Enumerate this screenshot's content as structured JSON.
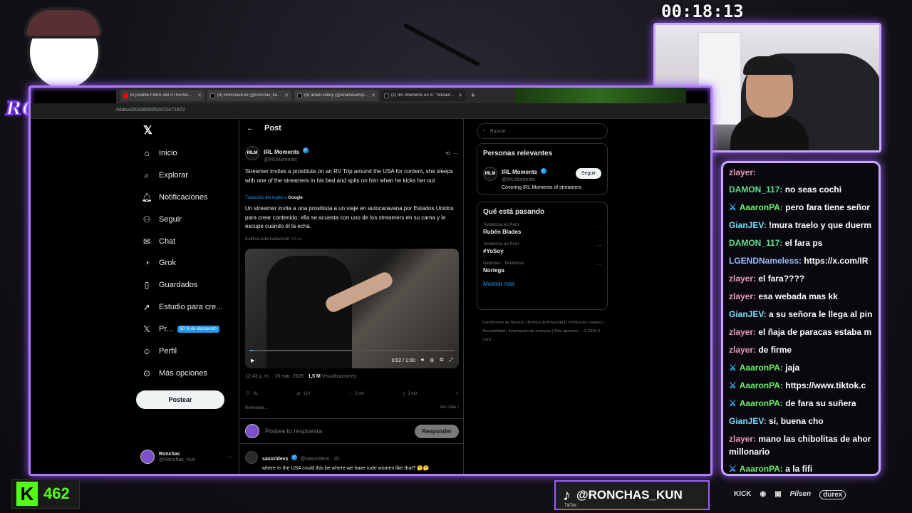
{
  "overlay": {
    "timer": "00:18:13",
    "logo_text": "RONCHAS",
    "kick_count": "462",
    "tiktok_label": "TikTok",
    "tiktok_handle": "@RONCHAS_KUN",
    "sponsors": [
      "KICK",
      "Pilsen",
      "durex"
    ]
  },
  "browser": {
    "tabs": [
      {
        "label": "El posible FINAL del STREAM...",
        "icon_color": "#ff0000"
      },
      {
        "label": "(8) RonchasKun (@ronchas_ku...",
        "icon_color": "#000000"
      },
      {
        "label": "(8) anahi.valery (@anahiavamp...",
        "icon_color": "#000000"
      },
      {
        "label": "(1) IRL Moments en X: \"Streamer...",
        "icon_color": "#000000"
      }
    ],
    "url": "/status/2033600052472471872"
  },
  "nav": {
    "items": [
      {
        "label": "Inicio",
        "icon": "home-icon"
      },
      {
        "label": "Explorar",
        "icon": "search-icon"
      },
      {
        "label": "Notificaciones",
        "icon": "bell-icon"
      },
      {
        "label": "Seguir",
        "icon": "follow-icon"
      },
      {
        "label": "Chat",
        "icon": "chat-icon"
      },
      {
        "label": "Grok",
        "icon": "grok-icon"
      },
      {
        "label": "Guardados",
        "icon": "bookmark-icon"
      },
      {
        "label": "Estudio para cre...",
        "icon": "rocket-icon"
      },
      {
        "label": "Pr...",
        "icon": "x-premium-icon"
      },
      {
        "label": "Perfil",
        "icon": "profile-icon"
      },
      {
        "label": "Más opciones",
        "icon": "more-icon"
      }
    ],
    "premium_badge": "50 % de descuento",
    "post_button": "Postear",
    "account_name": "Ronchas",
    "account_handle": "@Ronchas_Kun"
  },
  "post": {
    "header": "Post",
    "author_name": "IRL Moments",
    "author_handle": "@IRLMoments",
    "text": "Streamer invites a prostitute on an RV Trip around the USA for content, she sleeps with one of the streamers in his bed and spits on him when he kicks her out",
    "translated_prefix": "Traducido del inglés a",
    "translated_by": "Google",
    "translation": "Un streamer invita a una prostituta a un viaje en autocaravana por Estados Unidos para crear contenido; ella se acuesta con uno de los streamers en su cama y le escupe cuando él la echa.",
    "rate_translation": "Califica esta traducción:",
    "video_time": "0:02 / 1:00",
    "timestamp": "12:43 p. m. · 16 mar. 2026 ·",
    "views_count": "1,5 M",
    "views_label": "Visualizaciones",
    "replies": "91",
    "reposts": "110",
    "likes": "2 mil",
    "bookmarks": "2 mil",
    "sort": "Relevante",
    "view_quotes": "Ver citas",
    "reply_placeholder": "Postea tu respuesta",
    "reply_button": "Responder",
    "comment_name": "sasoridevs",
    "comment_handle": "@sasoridevs · 2h",
    "comment_text": "where In the USA could this be where we have rude women like that? 🤔🤔"
  },
  "sidebar": {
    "search_placeholder": "Buscar",
    "relevant_title": "Personas relevantes",
    "relevant_name": "IRL Moments",
    "relevant_handle": "@IRLMoments",
    "relevant_bio": "Covering IRL Moments of streamers",
    "follow_button": "Seguir",
    "trends_title": "Qué está pasando",
    "trends": [
      {
        "context": "Tendencia en Perú",
        "title": "Rubén Blades"
      },
      {
        "context": "Tendencia en Perú",
        "title": "#YoSoy"
      },
      {
        "context": "Deportes · Tendencia",
        "title": "Noriega"
      }
    ],
    "show_more": "Mostrar más",
    "footer": "Condiciones de Servicio | Política de Privacidad | Política de cookies | Accesibilidad | Información de anuncios | Más opciones ... © 2026 X Corp."
  },
  "chat": {
    "messages": [
      {
        "user": "zlayer:",
        "text": "",
        "color": "#e89ab8",
        "sword": false
      },
      {
        "user": "DAMON_117:",
        "text": "no seas cochi",
        "color": "#5de08c",
        "sword": false
      },
      {
        "user": "AaaronPA:",
        "text": "pero fara tiene señor",
        "color": "#6af06a",
        "sword": true
      },
      {
        "user": "GianJEV:",
        "text": "!mura traelo y que duerm",
        "color": "#77e0ff",
        "sword": false
      },
      {
        "user": "DAMON_117:",
        "text": "el fara ps",
        "color": "#5de08c",
        "sword": false
      },
      {
        "user": "LGENDNameless:",
        "text": "https://x.com/IR",
        "color": "#9fb8ff",
        "sword": false
      },
      {
        "user": "zlayer:",
        "text": "el fara????",
        "color": "#e89ab8",
        "sword": false
      },
      {
        "user": "zlayer:",
        "text": "esa webada mas kk",
        "color": "#e89ab8",
        "sword": false
      },
      {
        "user": "GianJEV:",
        "text": "a su señora le llega al pin",
        "color": "#77e0ff",
        "sword": false
      },
      {
        "user": "zlayer:",
        "text": "el ñaja de paracas estaba m",
        "color": "#e89ab8",
        "sword": false
      },
      {
        "user": "zlayer:",
        "text": "de firme",
        "color": "#e89ab8",
        "sword": false
      },
      {
        "user": "AaaronPA:",
        "text": "jaja",
        "color": "#6af06a",
        "sword": true
      },
      {
        "user": "AaaronPA:",
        "text": "https://www.tiktok.c",
        "color": "#6af06a",
        "sword": true
      },
      {
        "user": "AaaronPA:",
        "text": "de fara su suñera",
        "color": "#6af06a",
        "sword": true
      },
      {
        "user": "GianJEV:",
        "text": "sí, buena cho",
        "color": "#77e0ff",
        "sword": false
      },
      {
        "user": "zlayer:",
        "text": "mano las chibolitas de ahor",
        "color": "#e89ab8",
        "sword": false
      },
      {
        "user": "",
        "text": "millonario",
        "color": "#e89ab8",
        "sword": false
      },
      {
        "user": "AaaronPA:",
        "text": "a la fifi",
        "color": "#6af06a",
        "sword": true
      }
    ]
  }
}
